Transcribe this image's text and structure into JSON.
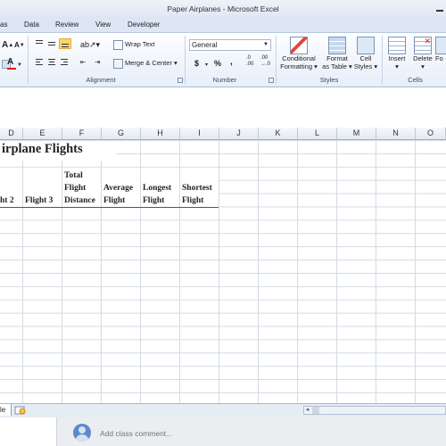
{
  "window": {
    "title": "Paper Airplanes  -  Microsoft Excel"
  },
  "tabs": [
    "as",
    "Data",
    "Review",
    "View",
    "Developer"
  ],
  "ribbon": {
    "font_group": {
      "grow_font": "A",
      "shrink_font": "A",
      "font_color": "A"
    },
    "alignment": {
      "label": "Alignment",
      "wrap_text": "Wrap Text",
      "merge_center": "Merge & Center"
    },
    "number": {
      "label": "Number",
      "format_value": "General",
      "currency": "$",
      "percent": "%",
      "comma": ",",
      "increase_decimal": ".0\n.00",
      "decrease_decimal": ".00\n→.0"
    },
    "styles": {
      "label": "Styles",
      "conditional_formatting": [
        "Conditional",
        "Formatting"
      ],
      "format_as_table": [
        "Format",
        "as Table"
      ],
      "cell_styles": [
        "Cell",
        "Styles"
      ]
    },
    "cells": {
      "label": "Cells",
      "insert": "Insert",
      "delete": "Delete",
      "format": "Fo"
    }
  },
  "columns": [
    "D",
    "E",
    "F",
    "G",
    "H",
    "I",
    "J",
    "K",
    "L",
    "M",
    "N",
    "O"
  ],
  "sheet": {
    "title": "irplane Flights",
    "headers": [
      [
        "ht 2"
      ],
      [
        "Flight 3"
      ],
      [
        "Total",
        "Flight",
        "Distance"
      ],
      [
        "Average",
        "Flight"
      ],
      [
        "Longest",
        "Flight"
      ],
      [
        "Shortest",
        "Flight"
      ]
    ]
  },
  "sheet_tab": {
    "label": "le"
  },
  "comment": {
    "placeholder": "Add class comment..."
  },
  "colors": {
    "ribbon_bg": "#e6eef9",
    "grid_line": "#d4dbe4",
    "avatar": "#5e88c9"
  }
}
